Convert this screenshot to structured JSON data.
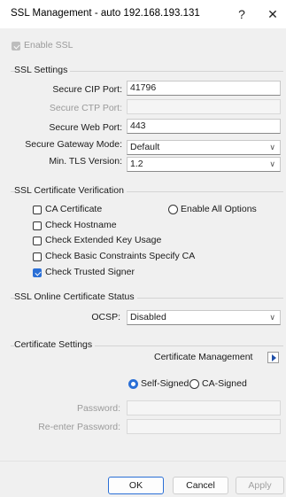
{
  "window": {
    "title": "SSL Management - auto 192.168.193.131",
    "help_glyph": "?",
    "close_glyph": "✕"
  },
  "enable_ssl": {
    "label": "Enable SSL",
    "checked": true,
    "disabled": true
  },
  "ssl_settings": {
    "title": "SSL Settings",
    "secure_cip_port": {
      "label": "Secure CIP Port:",
      "value": "41796"
    },
    "secure_ctp_port": {
      "label": "Secure CTP Port:",
      "value": ""
    },
    "secure_web_port": {
      "label": "Secure Web Port:",
      "value": "443"
    },
    "secure_gateway_mode": {
      "label": "Secure Gateway Mode:",
      "value": "Default"
    },
    "min_tls_version": {
      "label": "Min. TLS Version:",
      "value": "1.2"
    }
  },
  "cert_verification": {
    "title": "SSL Certificate Verification",
    "ca_certificate": {
      "label": "CA Certificate",
      "checked": false
    },
    "enable_all": {
      "label": "Enable All Options",
      "selected": false
    },
    "check_hostname": {
      "label": "Check Hostname",
      "checked": false
    },
    "check_eku": {
      "label": "Check Extended Key Usage",
      "checked": false
    },
    "check_basic": {
      "label": "Check Basic Constraints Specify CA",
      "checked": false
    },
    "check_trusted": {
      "label": "Check Trusted Signer",
      "checked": true
    }
  },
  "online_status": {
    "title": "SSL Online Certificate Status",
    "ocsp": {
      "label": "OCSP:",
      "value": "Disabled"
    }
  },
  "cert_settings": {
    "title": "Certificate Settings",
    "management_label": "Certificate Management",
    "self_signed": {
      "label": "Self-Signed",
      "selected": true
    },
    "ca_signed": {
      "label": "CA-Signed",
      "selected": false
    },
    "password": {
      "label": "Password:",
      "value": ""
    },
    "reenter_password": {
      "label": "Re-enter Password:",
      "value": ""
    }
  },
  "buttons": {
    "ok": "OK",
    "cancel": "Cancel",
    "apply": "Apply"
  },
  "colors": {
    "accent": "#2a6fd6",
    "dialog_bg": "#f0f0f0",
    "titlebar_bg": "#ffffff"
  },
  "icons": {
    "expand": "play-arrow-icon",
    "dropdown": "chevron-down-icon",
    "close": "close-icon",
    "help": "help-icon"
  }
}
